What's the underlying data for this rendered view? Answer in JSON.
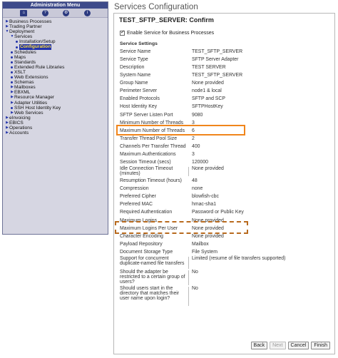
{
  "nav": {
    "title": "Administration Menu",
    "icons": [
      "home-icon",
      "help-icon",
      "tools-icon",
      "info-icon"
    ],
    "tree": [
      {
        "label": "Business Processes",
        "level": 0,
        "type": "collapsed"
      },
      {
        "label": "Trading Partner",
        "level": 0,
        "type": "collapsed"
      },
      {
        "label": "Deployment",
        "level": 0,
        "type": "expanded"
      },
      {
        "label": "Services",
        "level": 1,
        "type": "expanded"
      },
      {
        "label": "Installation/Setup",
        "level": 2,
        "type": "leaf"
      },
      {
        "label": "Configuration",
        "level": 2,
        "type": "leaf",
        "selected": true
      },
      {
        "label": "Schedules",
        "level": 1,
        "type": "leaf"
      },
      {
        "label": "Maps",
        "level": 1,
        "type": "leaf"
      },
      {
        "label": "Standards",
        "level": 1,
        "type": "leaf"
      },
      {
        "label": "Extended Rule Libraries",
        "level": 1,
        "type": "leaf"
      },
      {
        "label": "XSLT",
        "level": 1,
        "type": "leaf"
      },
      {
        "label": "Web Extensions",
        "level": 1,
        "type": "leaf"
      },
      {
        "label": "Schemas",
        "level": 1,
        "type": "leaf"
      },
      {
        "label": "Mailboxes",
        "level": 1,
        "type": "collapsed"
      },
      {
        "label": "EBXML",
        "level": 1,
        "type": "collapsed"
      },
      {
        "label": "Resource Manager",
        "level": 1,
        "type": "collapsed"
      },
      {
        "label": "Adapter Utilities",
        "level": 1,
        "type": "collapsed"
      },
      {
        "label": "SSH Host Identity Key",
        "level": 1,
        "type": "leaf"
      },
      {
        "label": "Web Services",
        "level": 1,
        "type": "collapsed"
      },
      {
        "label": "eInvoicing",
        "level": 0,
        "type": "collapsed"
      },
      {
        "label": "EBICS",
        "level": 0,
        "type": "collapsed"
      },
      {
        "label": "Operations",
        "level": 0,
        "type": "collapsed"
      },
      {
        "label": "Accounts",
        "level": 0,
        "type": "collapsed"
      }
    ]
  },
  "page": {
    "title": "Services Configuration",
    "panel_title": "TEST_SFTP_SERVER: Confirm",
    "enable_label": "Enable Service for Business Processes",
    "enable_checked": true,
    "section_title": "Service Settings"
  },
  "settings": [
    {
      "label": "Service Name",
      "value": "TEST_SFTP_SERVER"
    },
    {
      "label": "Service Type",
      "value": "SFTP Server Adapter"
    },
    {
      "label": "Description",
      "value": "TEST SERVER"
    },
    {
      "label": "System Name",
      "value": "TEST_SFTP_SERVER"
    },
    {
      "label": "Group Name",
      "value": "None provided"
    },
    {
      "label": "Perimeter Server",
      "value": "node1 & local"
    },
    {
      "label": "Enabled Protocols",
      "value": "SFTP and SCP"
    },
    {
      "label": "Host Identity Key",
      "value": "SFTPHostKey"
    },
    {
      "label": "SFTP Server Listen Port",
      "value": "9080"
    },
    {
      "label": "Minimum Number of Threads",
      "value": "3"
    },
    {
      "label": "Maximum Number of Threads",
      "value": "6"
    },
    {
      "label": "Transfer Thread Pool Size",
      "value": "2"
    },
    {
      "label": "Channels Per Transfer Thread",
      "value": "400"
    },
    {
      "label": "Maximum Authentications",
      "value": "3"
    },
    {
      "label": "Session Timeout (secs)",
      "value": "120000"
    },
    {
      "label": "Idle Connection Timeout (minutes)",
      "value": "None provided"
    },
    {
      "label": "Resumption Timeout (hours)",
      "value": "48"
    },
    {
      "label": "Compression",
      "value": "none"
    },
    {
      "label": "Preferred Cipher",
      "value": "blowfish-cbc"
    },
    {
      "label": "Preferred MAC",
      "value": "hmac-sha1"
    },
    {
      "label": "Required Authentication",
      "value": "Password or Public Key"
    },
    {
      "label": "Maximum Logins",
      "value": "None provided"
    },
    {
      "label": "Maximum Logins Per User",
      "value": "None provided"
    },
    {
      "label": "Character Encoding",
      "value": "None provided"
    },
    {
      "label": "Payload Repository",
      "value": "Mailbox"
    },
    {
      "label": "Document Storage Type",
      "value": "File System"
    },
    {
      "label": "Support for concurrent duplicate-named file transfers",
      "value": "Limited (resume of file transfers supported)"
    },
    {
      "label": "Should the adapter be restricted to a certain group of users?",
      "value": "No"
    },
    {
      "label": "Should users start in the directory that matches their user name upon login?",
      "value": "No"
    }
  ],
  "buttons": {
    "back": "Back",
    "next": "Next",
    "cancel": "Cancel",
    "finish": "Finish"
  },
  "highlight_colors": {
    "orange_box": "#f0851b",
    "dashed_box": "#b86a1e"
  }
}
